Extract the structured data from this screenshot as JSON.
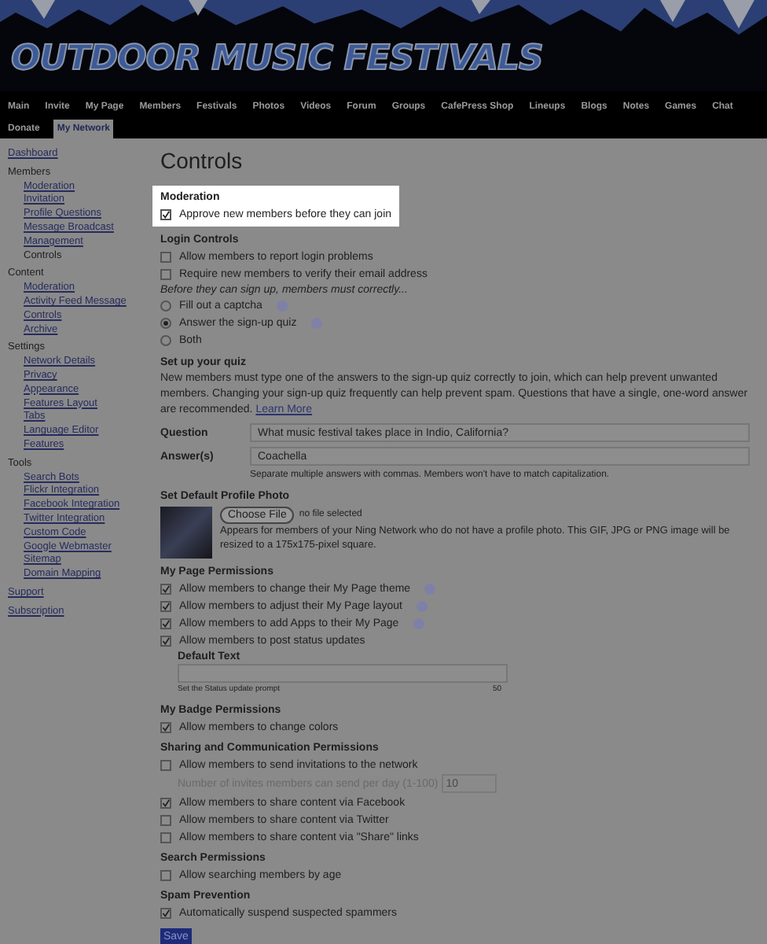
{
  "header": {
    "logo": "OUTDOOR MUSIC FESTIVALS"
  },
  "nav": [
    {
      "label": "Main",
      "selected": false
    },
    {
      "label": "Invite",
      "selected": false
    },
    {
      "label": "My Page",
      "selected": false
    },
    {
      "label": "Members",
      "selected": false
    },
    {
      "label": "Festivals",
      "selected": false
    },
    {
      "label": "Photos",
      "selected": false
    },
    {
      "label": "Videos",
      "selected": false
    },
    {
      "label": "Forum",
      "selected": false
    },
    {
      "label": "Groups",
      "selected": false
    },
    {
      "label": "CafePress Shop",
      "selected": false
    },
    {
      "label": "Lineups",
      "selected": false
    },
    {
      "label": "Blogs",
      "selected": false
    },
    {
      "label": "Notes",
      "selected": false
    },
    {
      "label": "Games",
      "selected": false
    },
    {
      "label": "Chat",
      "selected": false
    },
    {
      "label": "Donate",
      "selected": false
    },
    {
      "label": "My Network",
      "selected": true
    }
  ],
  "sidebar": [
    {
      "kind": "link",
      "label": "Dashboard"
    },
    {
      "kind": "group",
      "label": "Members",
      "children": [
        {
          "label": "Moderation",
          "selected": false
        },
        {
          "label": "Invitation",
          "selected": false
        },
        {
          "label": "Profile Questions",
          "selected": false
        },
        {
          "label": "Message Broadcast",
          "selected": false
        },
        {
          "label": "Management",
          "selected": false
        },
        {
          "label": "Controls",
          "selected": true
        }
      ]
    },
    {
      "kind": "group",
      "label": "Content",
      "children": [
        {
          "label": "Moderation",
          "selected": false
        },
        {
          "label": "Activity Feed Message",
          "selected": false
        },
        {
          "label": "Controls",
          "selected": false
        },
        {
          "label": "Archive",
          "selected": false
        }
      ]
    },
    {
      "kind": "group",
      "label": "Settings",
      "children": [
        {
          "label": "Network Details",
          "selected": false
        },
        {
          "label": "Privacy",
          "selected": false
        },
        {
          "label": "Appearance",
          "selected": false
        },
        {
          "label": "Features Layout",
          "selected": false
        },
        {
          "label": "Tabs",
          "selected": false
        },
        {
          "label": "Language Editor",
          "selected": false
        },
        {
          "label": "Features",
          "selected": false
        }
      ]
    },
    {
      "kind": "group",
      "label": "Tools",
      "children": [
        {
          "label": "Search Bots",
          "selected": false
        },
        {
          "label": "Flickr Integration",
          "selected": false
        },
        {
          "label": "Facebook Integration",
          "selected": false
        },
        {
          "label": "Twitter Integration",
          "selected": false
        },
        {
          "label": "Custom Code",
          "selected": false
        },
        {
          "label": "Google Webmaster",
          "selected": false
        },
        {
          "label": "Sitemap",
          "selected": false
        },
        {
          "label": "Domain Mapping",
          "selected": false
        }
      ]
    },
    {
      "kind": "link",
      "label": "Support"
    },
    {
      "kind": "link",
      "label": "Subscription"
    }
  ],
  "main": {
    "title": "Controls",
    "sections": [
      {
        "heading": "Moderation",
        "highlighted": true,
        "items": [
          {
            "kind": "checkbox",
            "label": "Approve new members before they can join",
            "checked": true,
            "help": false
          }
        ]
      },
      {
        "heading": "Login Controls",
        "highlighted": false,
        "items": [
          {
            "kind": "checkbox",
            "label": "Allow members to report login problems",
            "checked": false,
            "help": false
          },
          {
            "kind": "checkbox",
            "label": "Require new members to verify their email address",
            "checked": false,
            "help": false
          },
          {
            "kind": "note",
            "text": "Before they can sign up, members must correctly..."
          },
          {
            "kind": "radio",
            "label": "Fill out a captcha",
            "selected": false,
            "help": true
          },
          {
            "kind": "radio",
            "label": "Answer the sign-up quiz",
            "selected": true,
            "help": true
          },
          {
            "kind": "radio",
            "label": "Both",
            "selected": false,
            "help": false
          }
        ]
      },
      {
        "heading": "Set up your quiz",
        "highlighted": false,
        "items": [
          {
            "kind": "paragraph",
            "text": "New members must type one of the answers to the sign-up quiz correctly to join, which can help prevent unwanted members. Changing your sign-up quiz frequently can help prevent spam. Questions that have a single, one-word answer are recommended.",
            "link": "Learn More"
          },
          {
            "kind": "field",
            "label": "Question",
            "value": "What music festival takes place in Indio, California?"
          },
          {
            "kind": "field",
            "label": "Answer(s)",
            "value": "Coachella",
            "hint": "Separate multiple answers with commas. Members won't have to match capitalization."
          }
        ]
      },
      {
        "heading": "Set Default Profile Photo",
        "highlighted": false,
        "items": [
          {
            "kind": "photo",
            "button": "Choose File",
            "status": "no file selected",
            "text": "Appears for members of your Ning Network who do not have a profile photo. This GIF, JPG or PNG image will be resized to a 175x175-pixel square."
          }
        ]
      },
      {
        "heading": "My Page Permissions",
        "highlighted": false,
        "items": [
          {
            "kind": "checkbox",
            "label": "Allow members to change their My Page theme",
            "checked": true,
            "help": true
          },
          {
            "kind": "checkbox",
            "label": "Allow members to adjust their My Page layout",
            "checked": true,
            "help": true
          },
          {
            "kind": "checkbox",
            "label": "Allow members to add Apps to their My Page",
            "checked": true,
            "help": true
          },
          {
            "kind": "checkbox",
            "label": "Allow members to post status updates",
            "checked": true,
            "help": false
          },
          {
            "kind": "textarea",
            "label": "Default Text",
            "hint": "Set the Status update prompt",
            "counter": "50"
          }
        ]
      },
      {
        "heading": "My Badge Permissions",
        "highlighted": false,
        "items": [
          {
            "kind": "checkbox",
            "label": "Allow members to change colors",
            "checked": true,
            "help": false
          }
        ]
      },
      {
        "heading": "Sharing and Communication Permissions",
        "highlighted": false,
        "items": [
          {
            "kind": "checkbox",
            "label": "Allow members to send invitations to the network",
            "checked": false,
            "help": false
          },
          {
            "kind": "number",
            "label": "Number of invites members can send per day (1-100)",
            "value": "10",
            "disabled": true
          },
          {
            "kind": "checkbox",
            "label": "Allow members to share content via Facebook",
            "checked": true,
            "help": false
          },
          {
            "kind": "checkbox",
            "label": "Allow members to share content via Twitter",
            "checked": false,
            "help": false
          },
          {
            "kind": "checkbox",
            "label": "Allow members to share content via \"Share\" links",
            "checked": false,
            "help": false
          }
        ]
      },
      {
        "heading": "Search Permissions",
        "highlighted": false,
        "items": [
          {
            "kind": "checkbox",
            "label": "Allow searching members by age",
            "checked": false,
            "help": false
          }
        ]
      },
      {
        "heading": "Spam Prevention",
        "highlighted": false,
        "items": [
          {
            "kind": "checkbox",
            "label": "Automatically suspend suspected spammers",
            "checked": true,
            "help": false
          }
        ]
      }
    ],
    "save": "Save"
  }
}
